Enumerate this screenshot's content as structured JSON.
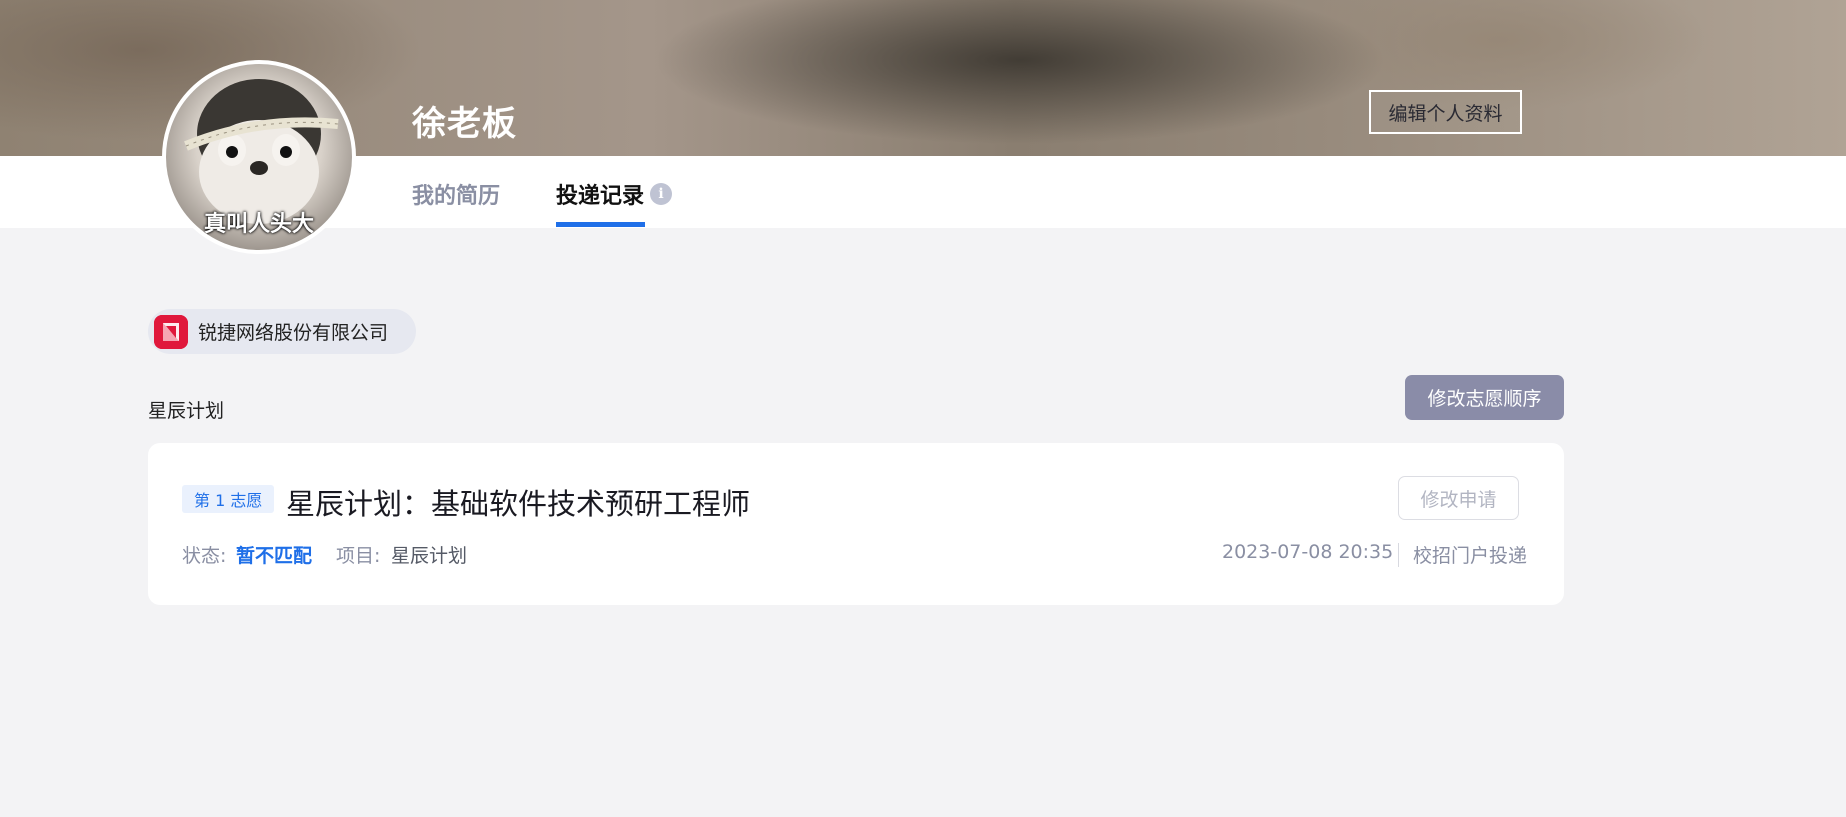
{
  "header": {
    "user_name": "徐老板",
    "edit_profile_label": "编辑个人资料",
    "avatar_caption": "真叫人头大"
  },
  "tabs": [
    {
      "label": "我的简历",
      "active": false
    },
    {
      "label": "投递记录",
      "active": true,
      "info_icon": "info-icon"
    }
  ],
  "company": {
    "name": "锐捷网络股份有限公司",
    "logo_color": "#e0183c"
  },
  "program": {
    "name": "星辰计划",
    "modify_order_label": "修改志愿顺序"
  },
  "application": {
    "preference_badge": "第 1 志愿",
    "job_title": "星辰计划：基础软件技术预研工程师",
    "modify_label": "修改申请",
    "status_label": "状态:",
    "status_value": "暂不匹配",
    "project_label": "项目:",
    "project_value": "星辰计划",
    "submitted_at": "2023-07-08 20:35",
    "source": "校招门户投递"
  },
  "colors": {
    "accent": "#1f6fe8",
    "button_muted": "#8a8ca8",
    "background": "#f3f3f5"
  }
}
